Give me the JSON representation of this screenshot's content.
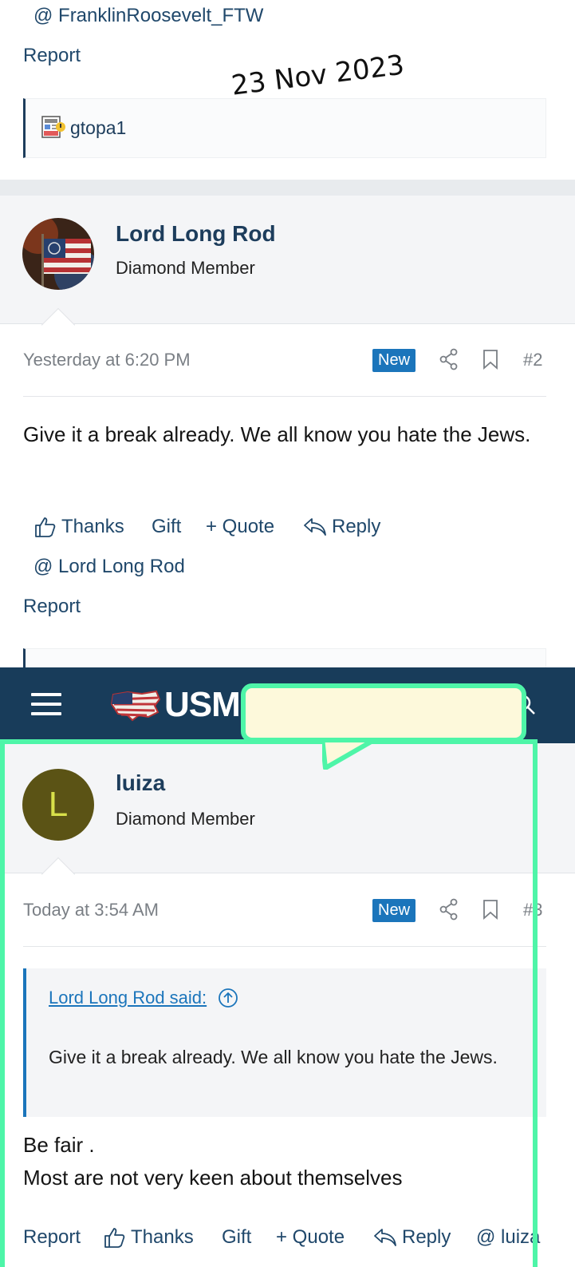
{
  "top": {
    "mention": "@ FranklinRoosevelt_FTW",
    "report": "Report",
    "date_stamp": "23 Nov 2023",
    "signature_user": "gtopa1"
  },
  "post2": {
    "username": "Lord Long Rod",
    "user_title": "Diamond Member",
    "timestamp": "Yesterday at 6:20 PM",
    "badge": "New",
    "post_number": "#2",
    "message": "Give it a break already. We all know you hate the Jews.",
    "actions": {
      "thanks": "Thanks",
      "gift": "Gift",
      "quote": "+ Quote",
      "reply": "Reply",
      "mention": "@ Lord Long Rod",
      "report": "Report"
    }
  },
  "navbar": {
    "brand": "USMI"
  },
  "post3": {
    "avatar_letter": "L",
    "username": "luiza",
    "user_title": "Diamond Member",
    "timestamp": "Today at 3:54 AM",
    "badge": "New",
    "post_number": "#3",
    "quote_author": "Lord Long Rod said:",
    "quote_text": "Give it a break already. We all know you hate the Jews.",
    "message_line1": "Be fair .",
    "message_line2": "Most are not very keen about themselves",
    "actions": {
      "report": "Report",
      "thanks": "Thanks",
      "gift": "Gift",
      "quote": "+ Quote",
      "reply": "Reply",
      "mention": "@ luiza"
    }
  },
  "colors": {
    "link": "#20486b",
    "badge": "#1b75bb",
    "navbar": "#183c5a",
    "highlight": "#4ef5a8"
  }
}
